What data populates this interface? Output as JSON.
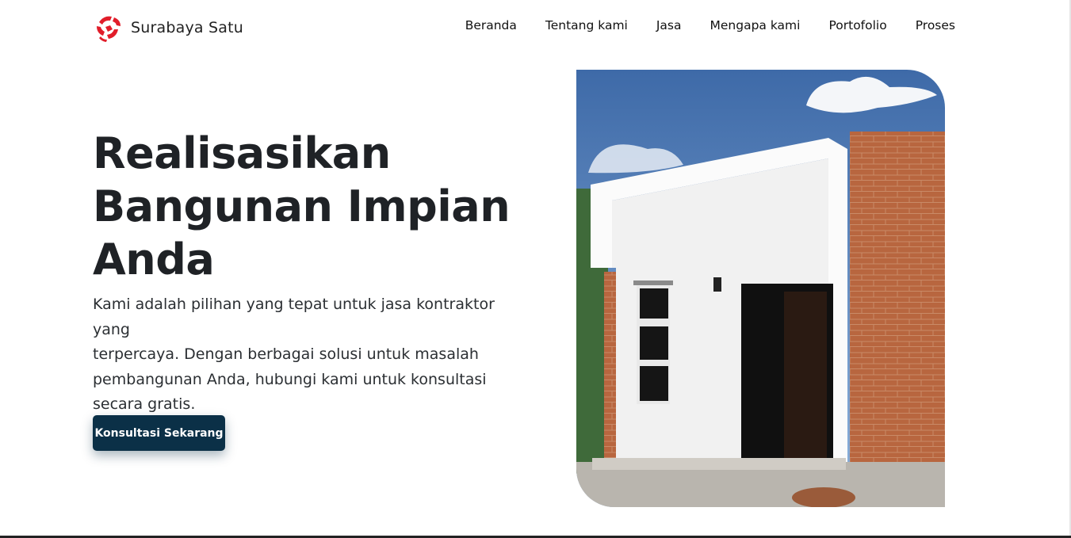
{
  "brand": {
    "name": "Surabaya Satu",
    "logo_icon": "red-s-swirl-logo-icon",
    "accent_color": "#e11d2a"
  },
  "nav": {
    "items": [
      "Beranda",
      "Tentang kami",
      "Jasa",
      "Mengapa kami",
      "Portofolio",
      "Proses"
    ]
  },
  "hero": {
    "title_lines": [
      "Realisasikan",
      "Bangunan Impian",
      "Anda"
    ],
    "text_lines": [
      "Kami adalah pilihan yang tepat untuk jasa kontraktor yang",
      "terpercaya. Dengan berbagai solusi untuk masalah",
      "pembangunan Anda, hubungi kami untuk konsultasi",
      "secara gratis."
    ],
    "cta_label": "Konsultasi Sekarang",
    "cta_color": "#0b3047"
  },
  "colors": {
    "text": "#212529",
    "background": "#ffffff"
  }
}
